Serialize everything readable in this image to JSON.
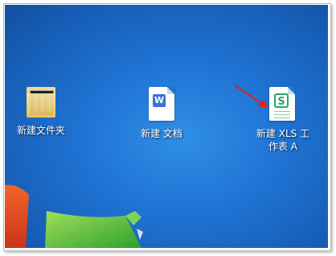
{
  "desktop": {
    "icons": [
      {
        "label": "新建文件夹"
      },
      {
        "label": "新建 文档"
      },
      {
        "label": "新建 XLS 工作表 A"
      }
    ]
  },
  "colors": {
    "wallpaper": "#1f73d4",
    "arrow": "#e02020",
    "xls_green": "#2aa56a",
    "wps_blue": "#3a72d8"
  }
}
